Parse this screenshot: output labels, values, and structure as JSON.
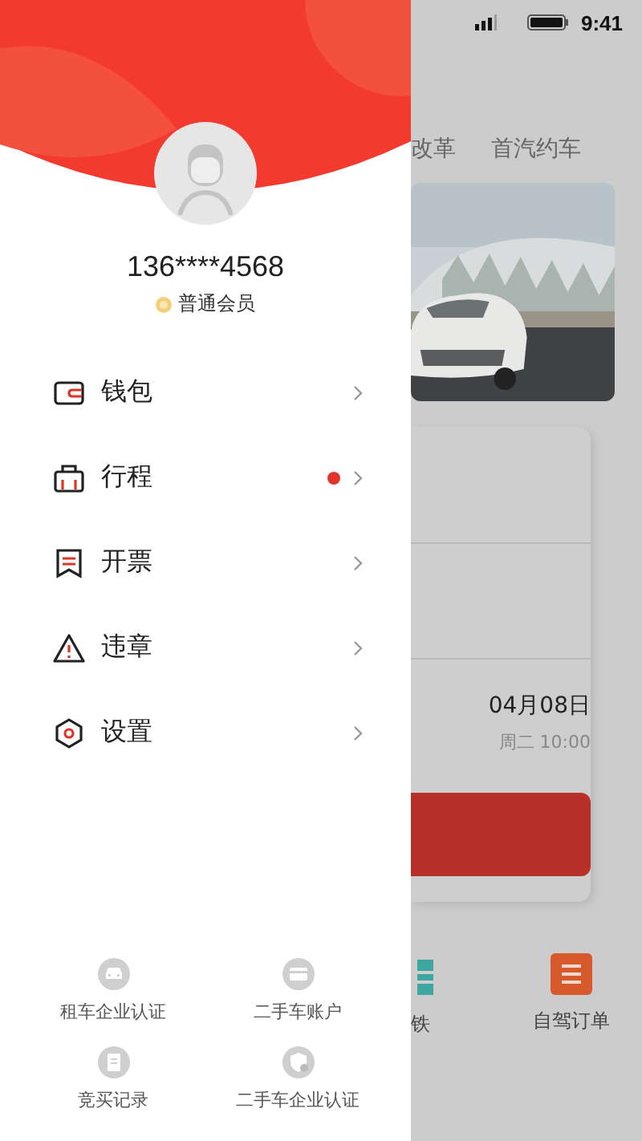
{
  "status_bar": {
    "time": "9:41"
  },
  "drawer": {
    "user": {
      "phone": "136****4568",
      "membership": "普通会员"
    },
    "menu": [
      {
        "label": "钱包",
        "dot": false
      },
      {
        "label": "行程",
        "dot": true
      },
      {
        "label": "开票",
        "dot": false
      },
      {
        "label": "违章",
        "dot": false
      },
      {
        "label": "设置",
        "dot": false
      }
    ],
    "shortcuts": [
      {
        "label": "租车企业认证"
      },
      {
        "label": "二手车账户"
      },
      {
        "label": "竞买记录"
      },
      {
        "label": "二手车企业认证"
      }
    ]
  },
  "background": {
    "tabs": [
      {
        "label": "改革"
      },
      {
        "label": "首汽约车"
      }
    ],
    "date": "04月08日",
    "weekday_time": "周二 10:00",
    "nav": [
      {
        "label": "铁"
      },
      {
        "label": "自驾订单"
      }
    ]
  }
}
